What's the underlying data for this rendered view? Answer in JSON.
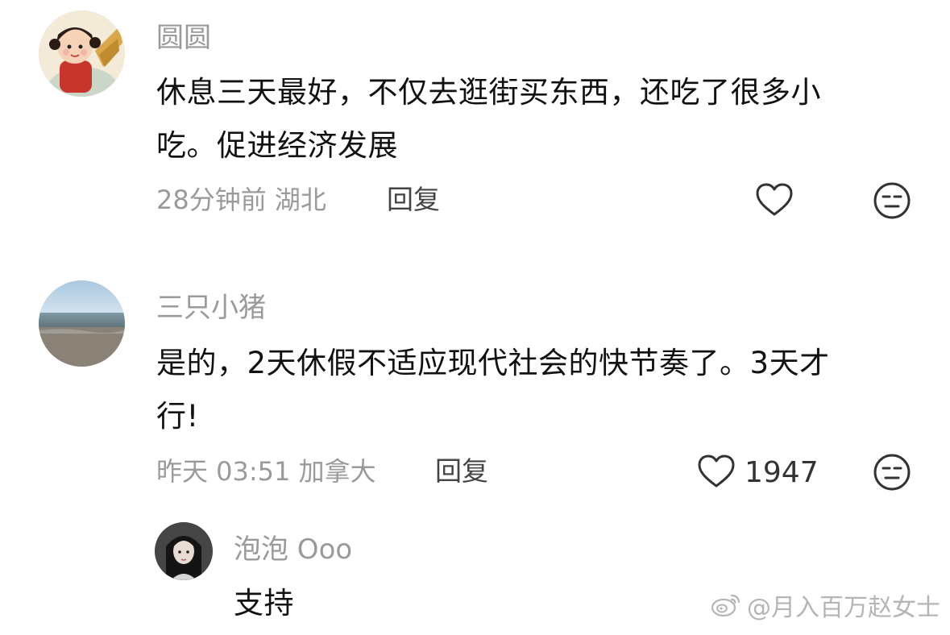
{
  "comments": [
    {
      "username": "圆圆",
      "text_line1": "休息三天最好，不仅去逛街买东西，还吃了很多小",
      "text_line2": "吃。促进经济发展",
      "time_location": "28分钟前 湖北",
      "reply_label": "回复",
      "like_count": ""
    },
    {
      "username": "三只小猪",
      "text_line1": "是的，2天休假不适应现代社会的快节奏了。3天才",
      "text_line2": "行!",
      "time_location": "昨天 03:51 加拿大",
      "reply_label": "回复",
      "like_count": "1947"
    }
  ],
  "sub_reply": {
    "username": "泡泡 Ooo",
    "text": "支持"
  },
  "watermark": {
    "text": "@月入百万赵女士",
    "icon": "weibo-icon"
  },
  "icons": {
    "like": "heart-outline-icon",
    "dislike": "meh-face-icon"
  },
  "colors": {
    "meta_text": "#9a9a9a",
    "body_text": "#111111",
    "icon_stroke": "#333333"
  }
}
